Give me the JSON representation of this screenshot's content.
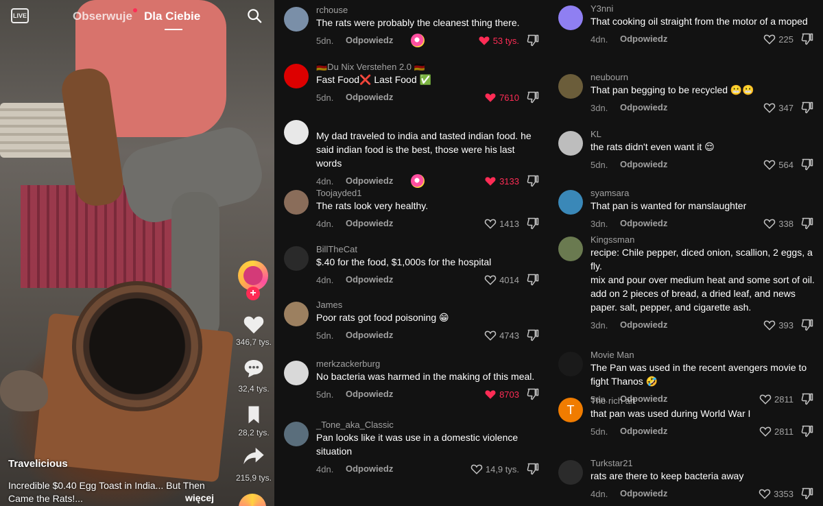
{
  "nav": {
    "live_label": "LIVE",
    "tab_following": "Obserwuje",
    "tab_foryou": "Dla Ciebie"
  },
  "video": {
    "author": "Travelicious",
    "description": "Incredible $0.40 Egg Toast in India... But Then Came the Rats!...",
    "more_label": "więcej",
    "likes": "346,7 tys.",
    "comments": "32,4 tys.",
    "saves": "28,2 tys.",
    "shares": "215,9 tys."
  },
  "reply_label": "Odpowiedz",
  "comments_left": [
    {
      "user": "rchouse",
      "text": "The rats were probably the cleanest thing there.",
      "time": "5dn.",
      "likes": "53 tys.",
      "liked": true,
      "creator": true,
      "avatar_color": "#7a8fa8"
    },
    {
      "user": "🇩🇪Du Nix Verstehen 2.0 🇩🇪",
      "text": "Fast Food❌ Last Food ✅",
      "time": "5dn.",
      "likes": "7610",
      "liked": true,
      "creator": false,
      "avatar_color": "#dd0000"
    },
    {
      "user": "",
      "text": "My dad traveled to india and tasted indian food. he said indian food is the best, those were his last words",
      "time": "4dn.",
      "likes": "3133",
      "liked": true,
      "creator": true,
      "avatar_color": "#e8e8e8"
    },
    {
      "user": "Toojayded1",
      "text": "The rats look very healthy.",
      "time": "4dn.",
      "likes": "1413",
      "liked": false,
      "creator": false,
      "avatar_color": "#8a6d5a"
    },
    {
      "user": "BillTheCat",
      "text": "$.40 for the food, $1,000s for the hospital",
      "time": "4dn.",
      "likes": "4014",
      "liked": false,
      "creator": false,
      "avatar_color": "#2a2a2a"
    },
    {
      "user": "James",
      "text": "Poor rats got food poisoning 😁",
      "time": "5dn.",
      "likes": "4743",
      "liked": false,
      "creator": false,
      "avatar_color": "#9c8060"
    },
    {
      "user": "merkzackerburg",
      "text": "No bacteria was harmed in the making of this meal.",
      "time": "5dn.",
      "likes": "8703",
      "liked": true,
      "creator": false,
      "avatar_color": "#d9d9d9"
    },
    {
      "user": "_Tone_aka_Classic",
      "text": "Pan looks like it was use in a domestic violence situation",
      "time": "4dn.",
      "likes": "14,9 tys.",
      "liked": false,
      "creator": false,
      "avatar_color": "#5a6e7c"
    }
  ],
  "comments_right": [
    {
      "user": "Y3nni",
      "text": "That cooking oil straight from the motor of a moped",
      "time": "4dn.",
      "likes": "225",
      "liked": false,
      "avatar_color": "#8f7ff2"
    },
    {
      "user": "neubourn",
      "text": "That pan begging to be recycled 😬😬",
      "time": "3dn.",
      "likes": "347",
      "liked": false,
      "avatar_color": "#6b5d3a"
    },
    {
      "user": "KL",
      "text": "the rats didn't even want it 😌",
      "time": "5dn.",
      "likes": "564",
      "liked": false,
      "avatar_color": "#bdbdbd"
    },
    {
      "user": "syamsara",
      "text": "That pan is wanted for manslaughter",
      "time": "3dn.",
      "likes": "338",
      "liked": false,
      "avatar_color": "#3a88b8"
    },
    {
      "user": "Kingssman",
      "text": "recipe: Chile pepper, diced onion, scallion, 2 eggs, a fly.\nmix and pour over medium heat and some sort of oil.\nadd on 2 pieces of bread, a dried leaf, and news paper. salt, pepper, and cigarette ash.",
      "time": "3dn.",
      "likes": "393",
      "liked": false,
      "avatar_color": "#6a7a50"
    },
    {
      "user": "Movie Man",
      "text": "The Pan was used in the recent avengers movie to fight Thanos 🤣",
      "time": "5dn.",
      "likes": "2811",
      "liked": false,
      "avatar_color": "#1a1a1a"
    },
    {
      "user": "The rich art",
      "text": "that pan was used during World War I",
      "time": "5dn.",
      "likes": "2811",
      "liked": false,
      "avatar_color": "#f07c00",
      "avatar_letter": "T"
    },
    {
      "user": "Turkstar21",
      "text": "rats are there to keep bacteria away",
      "time": "4dn.",
      "likes": "3353",
      "liked": false,
      "avatar_color": "#2b2b2b"
    }
  ]
}
